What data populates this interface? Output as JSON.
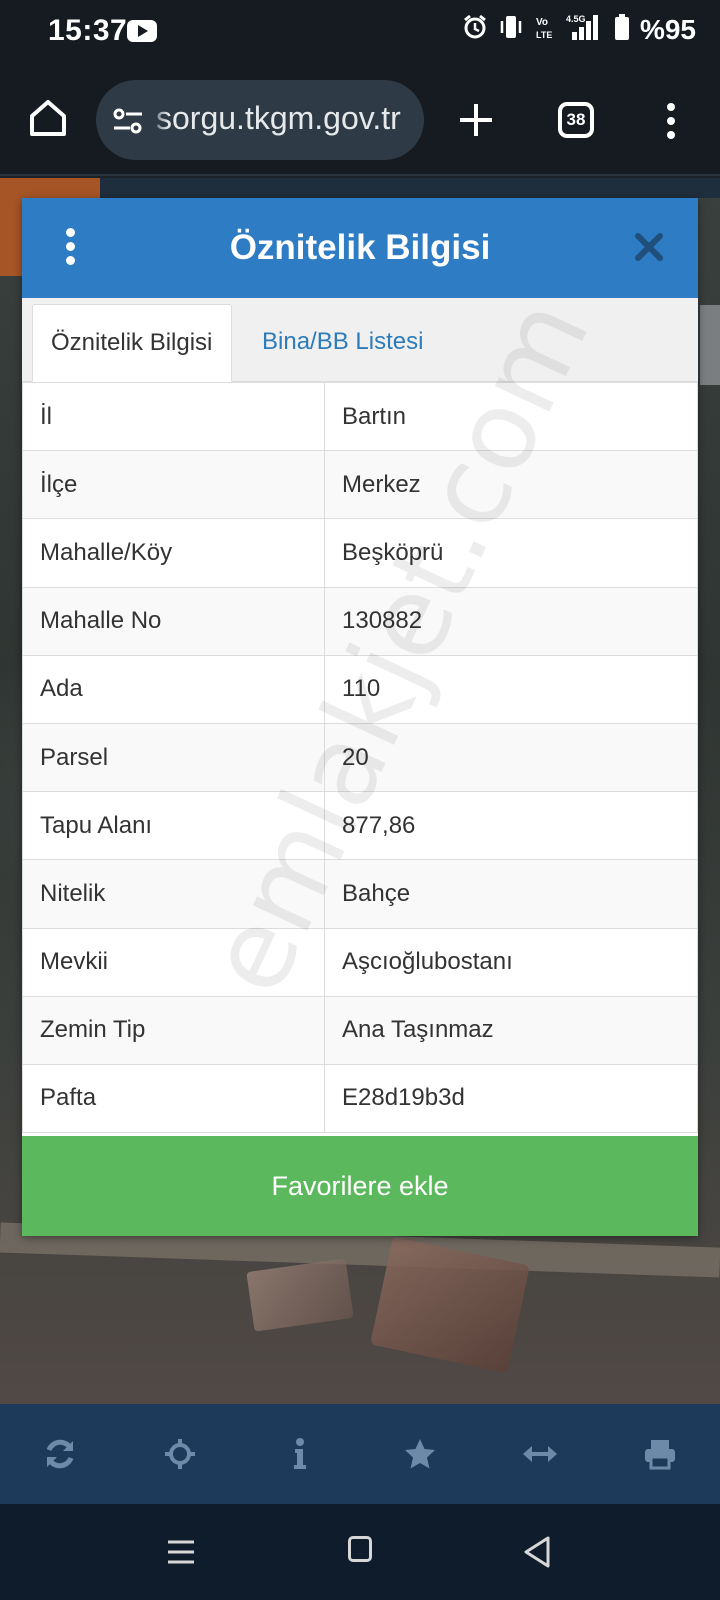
{
  "status_bar": {
    "time": "15:37",
    "network_label": "4.5G",
    "volte_label": "Vo LTE",
    "battery": "%95"
  },
  "browser": {
    "url": "sorgu.tkgm.gov.tr",
    "tab_count": "38"
  },
  "dialog": {
    "title": "Öznitelik Bilgisi",
    "tabs": [
      {
        "label": "Öznitelik Bilgisi",
        "active": true
      },
      {
        "label": "Bina/BB Listesi",
        "active": false
      }
    ],
    "rows": [
      {
        "key": "İl",
        "value": "Bartın"
      },
      {
        "key": "İlçe",
        "value": "Merkez"
      },
      {
        "key": "Mahalle/Köy",
        "value": "Beşköprü"
      },
      {
        "key": "Mahalle No",
        "value": "130882"
      },
      {
        "key": "Ada",
        "value": "110"
      },
      {
        "key": "Parsel",
        "value": "20"
      },
      {
        "key": "Tapu Alanı",
        "value": "877,86"
      },
      {
        "key": "Nitelik",
        "value": "Bahçe"
      },
      {
        "key": "Mevkii",
        "value": "Aşcıoğlubostanı"
      },
      {
        "key": "Zemin Tip",
        "value": "Ana Taşınmaz"
      },
      {
        "key": "Pafta",
        "value": "E28d19b3d"
      }
    ],
    "favorite_button": "Favorilere ekle"
  },
  "watermark": "emlakjet.com",
  "toolbar_icons": [
    "refresh-icon",
    "locate-icon",
    "info-icon",
    "star-icon",
    "measure-icon",
    "print-icon"
  ],
  "colors": {
    "header_blue": "#2e7cc4",
    "fav_green": "#5cb85c",
    "tab_link": "#2d7bb8",
    "toolbar_bg": "#1e3a5a"
  }
}
